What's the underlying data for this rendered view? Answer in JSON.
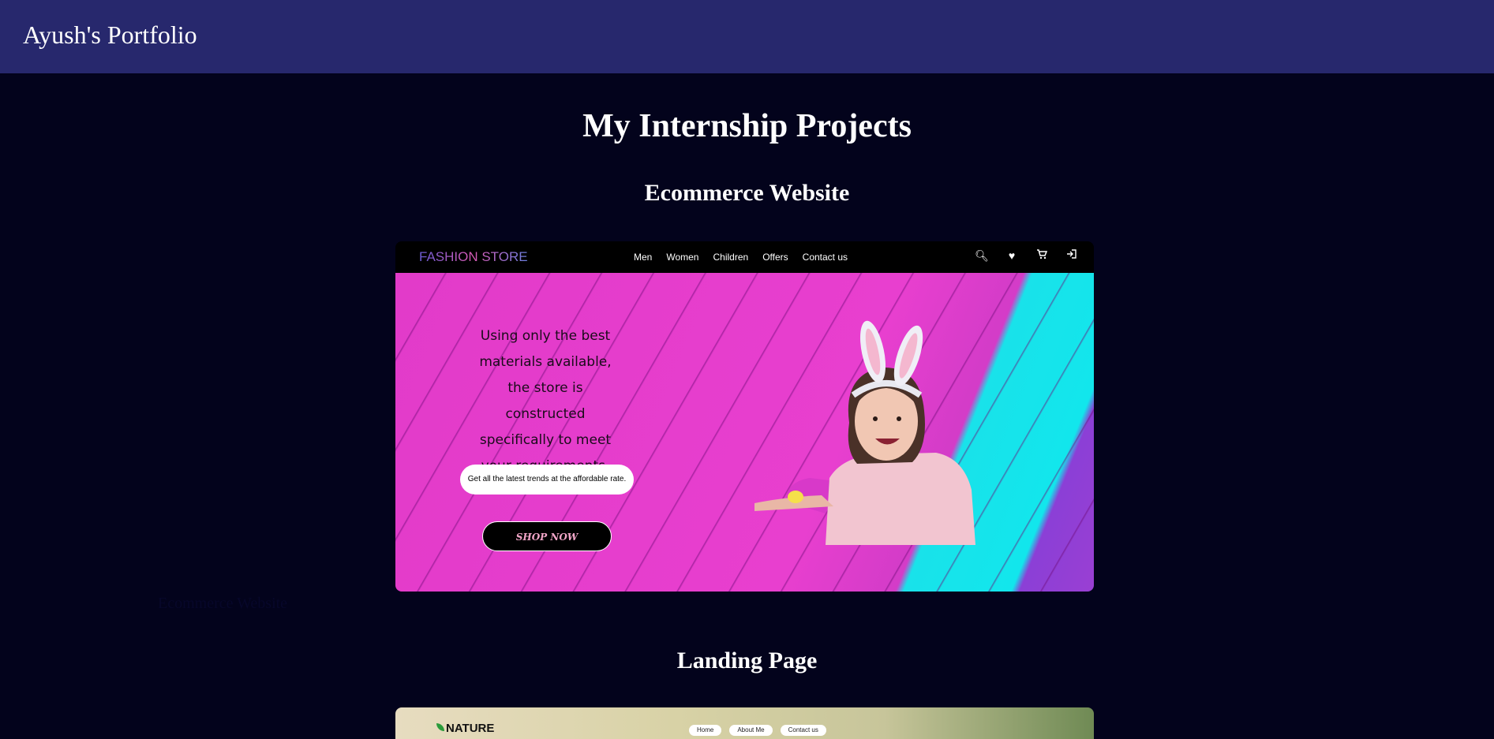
{
  "header": {
    "title": "Ayush's Portfolio"
  },
  "main": {
    "title": "My Internship Projects",
    "hidden_alt": "Ecommerce Website",
    "projects": [
      {
        "title": "Ecommerce Website",
        "preview": {
          "logo": "FASHION STORE",
          "menu": [
            "Men",
            "Women",
            "Children",
            "Offers",
            "Contact us"
          ],
          "icons": [
            "search-icon",
            "heart-icon",
            "cart-icon",
            "login-icon"
          ],
          "hero_text": "Using only the best materials available, the store is constructed specifically to meet your requirements.",
          "pill_text": "Get all the latest trends at the affordable rate.",
          "button": "SHOP NOW"
        }
      },
      {
        "title": "Landing Page",
        "preview": {
          "logo": "NATURE",
          "menu": [
            "Home",
            "About Me",
            "Contact us"
          ]
        }
      }
    ]
  },
  "colors": {
    "header_bg": "#27286d",
    "page_bg": "#03031c",
    "hero_pink": "#e83fcf",
    "hero_cyan": "#12e6ec"
  }
}
